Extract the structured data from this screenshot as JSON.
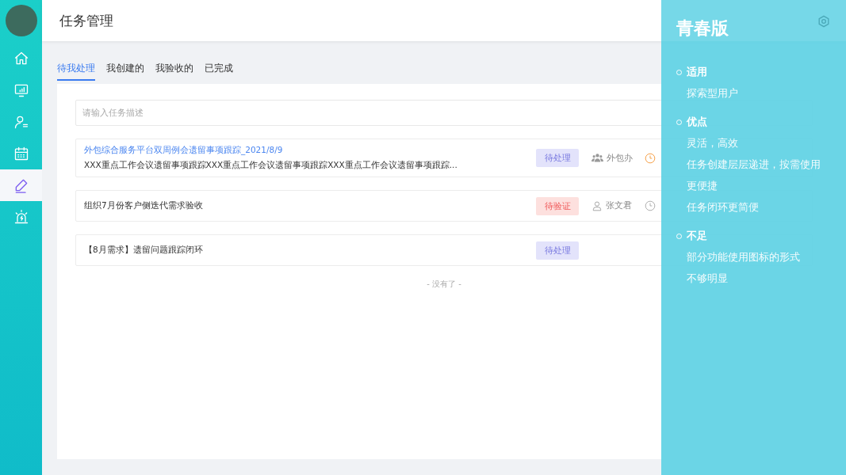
{
  "sidebar": {
    "items": [
      {
        "kind": "home",
        "selected": false
      },
      {
        "kind": "monitor",
        "selected": false
      },
      {
        "kind": "user-list",
        "selected": false
      },
      {
        "kind": "calendar",
        "selected": false
      },
      {
        "kind": "pencil",
        "selected": true
      },
      {
        "kind": "alarm",
        "selected": false
      }
    ]
  },
  "header": {
    "title": "任务管理"
  },
  "tabs": [
    {
      "label": "待我处理",
      "selected": true
    },
    {
      "label": "我创建的",
      "selected": false
    },
    {
      "label": "我验收的",
      "selected": false
    },
    {
      "label": "已完成",
      "selected": false
    }
  ],
  "search": {
    "placeholder": "请输入任务描述"
  },
  "tasks": [
    {
      "title": "外包综合服务平台双周例会遗留事项跟踪_2021/8/9",
      "highlighted": true,
      "description": "XXX重点工作会议遗留事项跟踪XXX重点工作会议遗留事项跟踪XXX重点工作会议遗留事项跟踪...",
      "status": {
        "label": "待处理",
        "kind": "pending"
      },
      "owner": {
        "name": "外包办",
        "kind": "group"
      },
      "due_urgent": true
    },
    {
      "title": "组织7月份客户侧迭代需求验收",
      "highlighted": false,
      "status": {
        "label": "待验证",
        "kind": "verify"
      },
      "owner": {
        "name": "张文君",
        "kind": "person"
      },
      "due_urgent": false
    },
    {
      "title": "【8月需求】遗留问题跟踪闭环",
      "highlighted": false,
      "status": {
        "label": "待处理",
        "kind": "pending"
      }
    }
  ],
  "end_note": "- 没有了 -",
  "overlay": {
    "title": "青春版",
    "sections": [
      {
        "heading": "适用",
        "lines": [
          "探索型用户"
        ]
      },
      {
        "heading": "优点",
        "lines": [
          "灵活，高效",
          "任务创建层层递进，按需使用",
          "更便捷",
          "任务闭环更简便"
        ]
      },
      {
        "heading": "不足",
        "lines": [
          "部分功能使用图标的形式",
          "不够明显"
        ]
      }
    ]
  }
}
